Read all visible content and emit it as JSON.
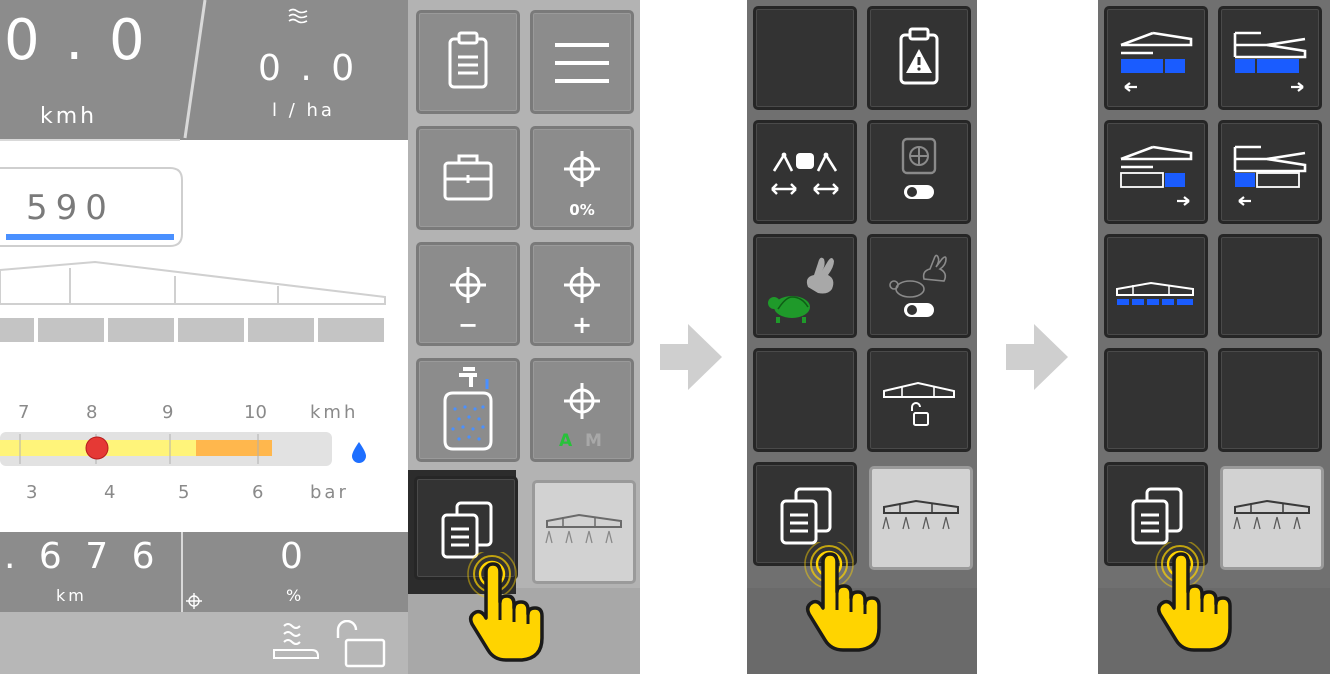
{
  "left_screen": {
    "speed": {
      "value": "0 . 0",
      "unit": "kmh"
    },
    "rate": {
      "value": "0 . 0",
      "unit": "l / ha"
    },
    "tank": {
      "value": "590"
    },
    "speed_scale": {
      "ticks": [
        "7",
        "8",
        "9",
        "10"
      ],
      "unit": "kmh",
      "cursor_fraction": 0.22
    },
    "pressure_scale": {
      "ticks": [
        "3",
        "4",
        "5",
        "6"
      ],
      "unit": "bar"
    },
    "distance": {
      "value": ". 6 7 6",
      "unit": "km"
    },
    "coverage": {
      "value": "0",
      "unit": "%"
    },
    "menu": {
      "target_percent": "0%",
      "target_minus": "−",
      "target_plus": "+",
      "mode_a": "A",
      "mode_m": "M"
    }
  },
  "colors": {
    "panel_gray": "#8c8c8c",
    "button_dark": "#333333",
    "accent_blue": "#1a5cff",
    "turtle_green": "#1f9a2a",
    "hand_yellow": "#ffd400",
    "speed_bar_yellow": "#fff47a",
    "speed_bar_orange": "#ffb74d",
    "cursor_red": "#e53935"
  },
  "icons": [
    "clipboard-icon",
    "hamburger-icon",
    "briefcase-icon",
    "target-icon",
    "tank-fill-icon",
    "pages-icon",
    "boom-icon",
    "hand-pointer-icon",
    "clipboard-alert-icon",
    "track-arms-icon",
    "fan-toggle-icon",
    "rabbit-turtle-icon",
    "boom-unlock-icon",
    "section-control-icon",
    "arrow-right-icon"
  ]
}
